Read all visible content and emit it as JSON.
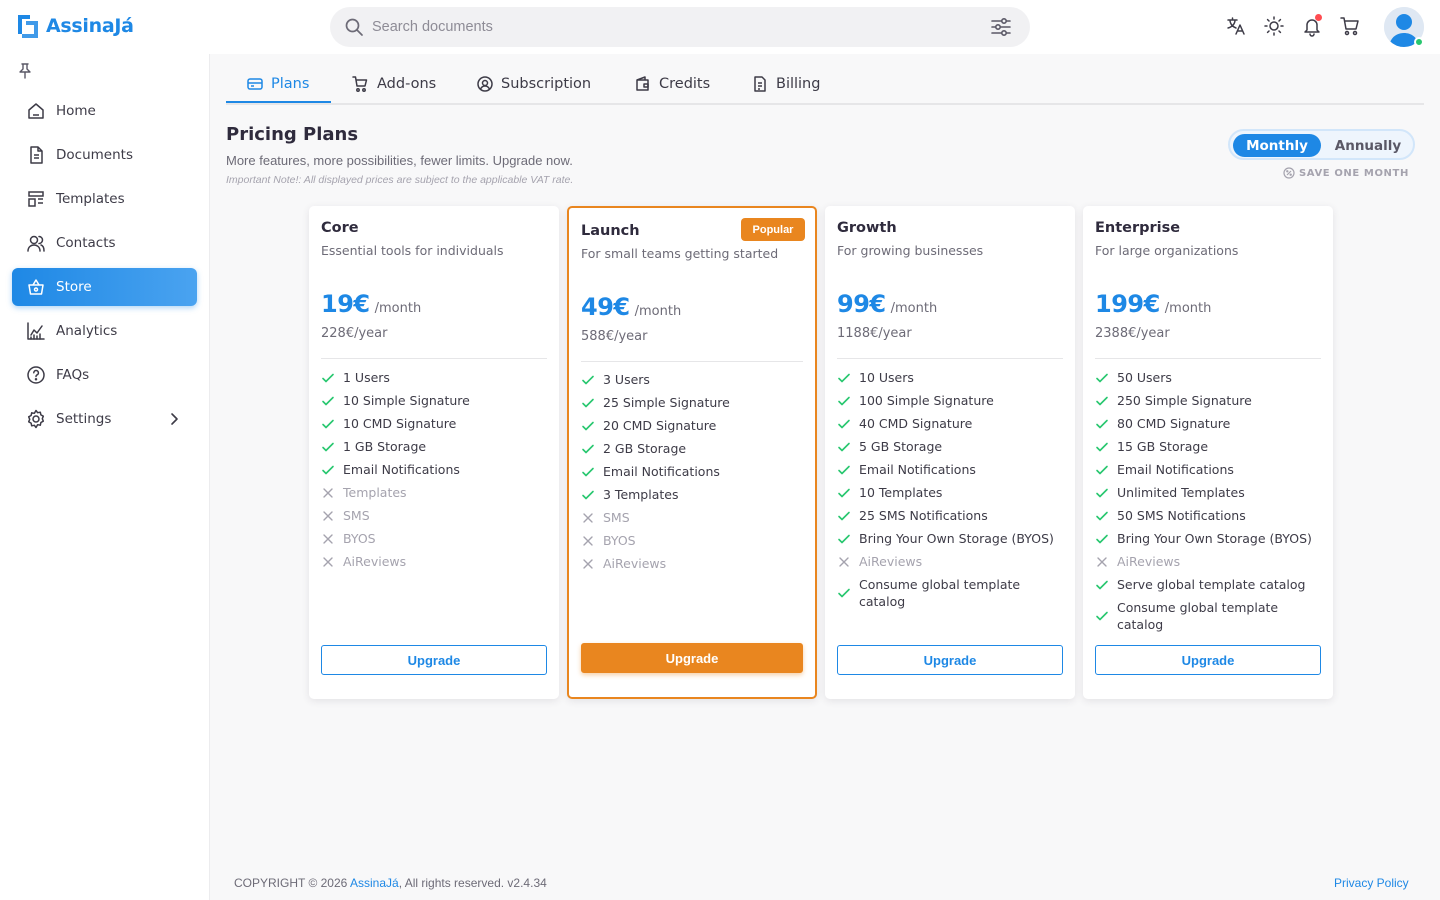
{
  "app": {
    "name": "AssinaJá",
    "accent": "#1e88e5",
    "highlight": "#e9861f"
  },
  "search": {
    "placeholder": "Search documents"
  },
  "topbar": {
    "icons": [
      "translate-icon",
      "sun-icon",
      "bell-icon",
      "cart-icon"
    ],
    "has_notification": true
  },
  "sidebar": {
    "items": [
      {
        "label": "Home",
        "icon": "home-icon"
      },
      {
        "label": "Documents",
        "icon": "document-icon"
      },
      {
        "label": "Templates",
        "icon": "templates-icon"
      },
      {
        "label": "Contacts",
        "icon": "contacts-icon"
      },
      {
        "label": "Store",
        "icon": "store-icon",
        "active": true
      },
      {
        "label": "Analytics",
        "icon": "analytics-icon"
      },
      {
        "label": "FAQs",
        "icon": "help-icon"
      },
      {
        "label": "Settings",
        "icon": "settings-icon",
        "has_submenu": true
      }
    ]
  },
  "tabs": [
    {
      "label": "Plans",
      "icon": "card-icon",
      "active": true
    },
    {
      "label": "Add-ons",
      "icon": "cart-plus-icon"
    },
    {
      "label": "Subscription",
      "icon": "user-circle-icon"
    },
    {
      "label": "Credits",
      "icon": "wallet-icon"
    },
    {
      "label": "Billing",
      "icon": "invoice-icon"
    }
  ],
  "page": {
    "title": "Pricing Plans",
    "subtitle": "More features, more possibilities, fewer limits. Upgrade now.",
    "note": "Important Note!: All displayed prices are subject to the applicable VAT rate."
  },
  "billing_toggle": {
    "monthly": "Monthly",
    "annually": "Annually",
    "selected": "Monthly",
    "save_note": "SAVE ONE MONTH"
  },
  "plans": [
    {
      "name": "Core",
      "description": "Essential tools for individuals",
      "price": "19€",
      "period": "/month",
      "yearly": "228€/year",
      "button": "Upgrade",
      "features": [
        {
          "text": "1 Users",
          "included": true
        },
        {
          "text": "10 Simple Signature",
          "included": true
        },
        {
          "text": "10 CMD Signature",
          "included": true
        },
        {
          "text": "1 GB Storage",
          "included": true
        },
        {
          "text": "Email Notifications",
          "included": true
        },
        {
          "text": "Templates",
          "included": false
        },
        {
          "text": "SMS",
          "included": false
        },
        {
          "text": "BYOS",
          "included": false
        },
        {
          "text": "AiReviews",
          "included": false
        }
      ]
    },
    {
      "name": "Launch",
      "description": "For small teams getting started",
      "price": "49€",
      "period": "/month",
      "yearly": "588€/year",
      "badge": "Popular",
      "button": "Upgrade",
      "features": [
        {
          "text": "3 Users",
          "included": true
        },
        {
          "text": "25 Simple Signature",
          "included": true
        },
        {
          "text": "20 CMD Signature",
          "included": true
        },
        {
          "text": "2 GB Storage",
          "included": true
        },
        {
          "text": "Email Notifications",
          "included": true
        },
        {
          "text": "3 Templates",
          "included": true
        },
        {
          "text": "SMS",
          "included": false
        },
        {
          "text": "BYOS",
          "included": false
        },
        {
          "text": "AiReviews",
          "included": false
        }
      ]
    },
    {
      "name": "Growth",
      "description": "For growing businesses",
      "price": "99€",
      "period": "/month",
      "yearly": "1188€/year",
      "button": "Upgrade",
      "features": [
        {
          "text": "10 Users",
          "included": true
        },
        {
          "text": "100 Simple Signature",
          "included": true
        },
        {
          "text": "40 CMD Signature",
          "included": true
        },
        {
          "text": "5 GB Storage",
          "included": true
        },
        {
          "text": "Email Notifications",
          "included": true
        },
        {
          "text": "10 Templates",
          "included": true
        },
        {
          "text": "25 SMS Notifications",
          "included": true
        },
        {
          "text": "Bring Your Own Storage (BYOS)",
          "included": true
        },
        {
          "text": "AiReviews",
          "included": false
        },
        {
          "text": "Consume global template catalog",
          "included": true
        }
      ]
    },
    {
      "name": "Enterprise",
      "description": "For large organizations",
      "price": "199€",
      "period": "/month",
      "yearly": "2388€/year",
      "button": "Upgrade",
      "features": [
        {
          "text": "50 Users",
          "included": true
        },
        {
          "text": "250 Simple Signature",
          "included": true
        },
        {
          "text": "80 CMD Signature",
          "included": true
        },
        {
          "text": "15 GB Storage",
          "included": true
        },
        {
          "text": "Email Notifications",
          "included": true
        },
        {
          "text": "Unlimited Templates",
          "included": true
        },
        {
          "text": "50 SMS Notifications",
          "included": true
        },
        {
          "text": "Bring Your Own Storage (BYOS)",
          "included": true
        },
        {
          "text": "AiReviews",
          "included": false
        },
        {
          "text": "Serve global template catalog",
          "included": true
        },
        {
          "text": "Consume global template catalog",
          "included": true
        }
      ]
    }
  ],
  "footer": {
    "copyright": "COPYRIGHT © 2026",
    "brand": "AssinaJá",
    "rights": ", All rights reserved.",
    "version": "v2.4.34",
    "privacy": "Privacy Policy"
  }
}
